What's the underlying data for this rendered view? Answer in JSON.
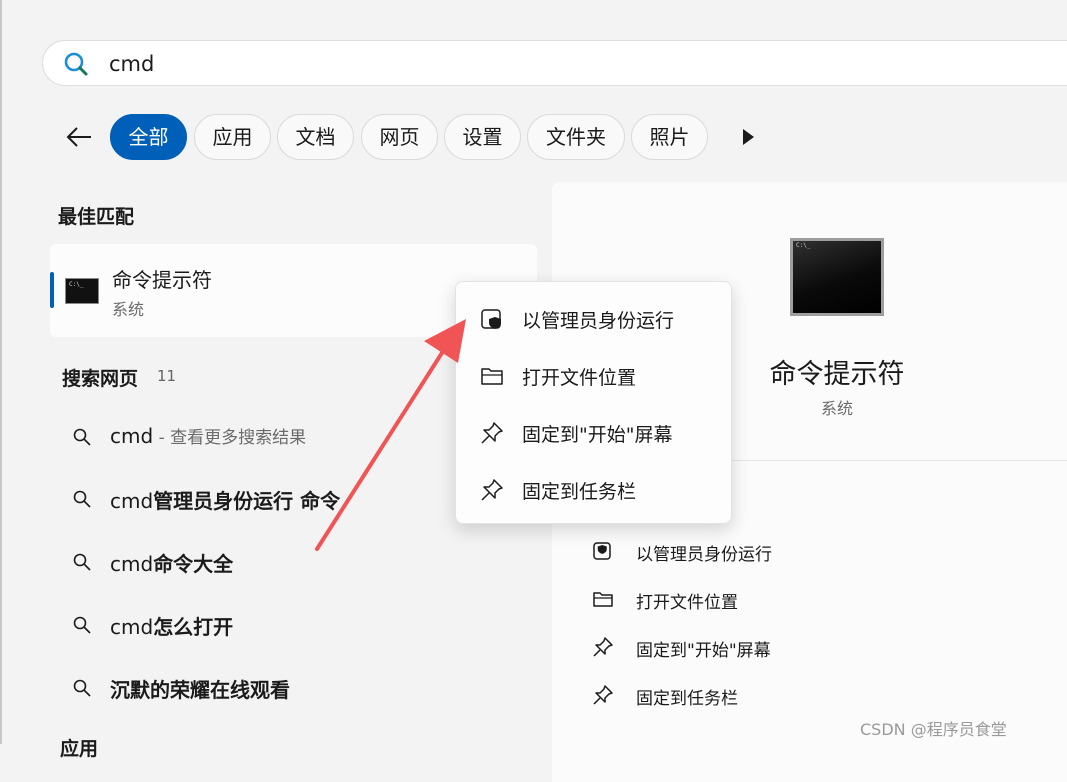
{
  "search": {
    "query": "cmd"
  },
  "filters": {
    "items": [
      "全部",
      "应用",
      "文档",
      "网页",
      "设置",
      "文件夹",
      "照片"
    ],
    "active_index": 0
  },
  "best_match": {
    "heading": "最佳匹配",
    "title": "命令提示符",
    "subtitle": "系统"
  },
  "web_search": {
    "heading": "搜索网页",
    "count": "11",
    "items": [
      {
        "prefix": "cmd",
        "bold": "",
        "suffix": " - 查看更多搜索结果"
      },
      {
        "prefix": "cmd",
        "bold": "管理员身份运行 命令",
        "suffix": ""
      },
      {
        "prefix": "cmd",
        "bold": "命令大全",
        "suffix": ""
      },
      {
        "prefix": "cmd",
        "bold": "怎么打开",
        "suffix": ""
      },
      {
        "prefix": "",
        "bold": "沉默的荣耀在线观看",
        "suffix": ""
      }
    ]
  },
  "apps_heading_peek": "应用",
  "preview": {
    "title": "命令提示符",
    "subtitle": "系统",
    "icon_text": "C:\\_",
    "actions": [
      {
        "icon": "shield-icon",
        "label": "以管理员身份运行"
      },
      {
        "icon": "folder-icon",
        "label": "打开文件位置"
      },
      {
        "icon": "pin-icon",
        "label": "固定到\"开始\"屏幕"
      },
      {
        "icon": "pin-icon",
        "label": "固定到任务栏"
      }
    ]
  },
  "context_menu": {
    "items": [
      {
        "icon": "shield-icon",
        "label": "以管理员身份运行"
      },
      {
        "icon": "folder-icon",
        "label": "打开文件位置"
      },
      {
        "icon": "pin-icon",
        "label": "固定到\"开始\"屏幕"
      },
      {
        "icon": "pin-icon",
        "label": "固定到任务栏"
      }
    ]
  },
  "cmd_icon_text": "C:\\_",
  "watermark": "CSDN @程序员食堂",
  "colors": {
    "accent": "#005fb8",
    "annotation_arrow": "#f05454",
    "search_icon": "#1a8fd6"
  }
}
